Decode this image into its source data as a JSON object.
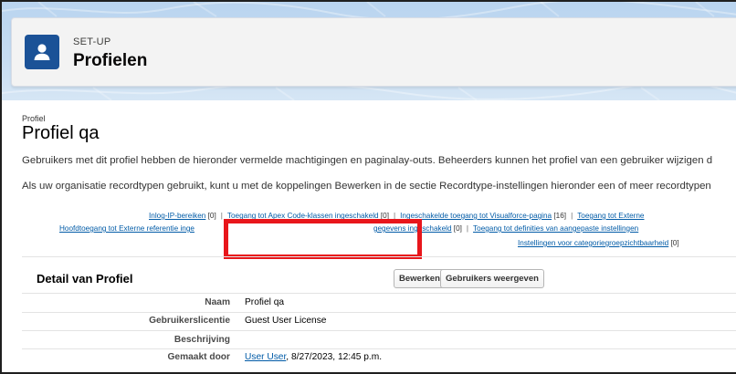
{
  "header": {
    "eyebrow": "SET-UP",
    "title": "Profielen"
  },
  "page": {
    "type_label": "Profiel",
    "title": "Profiel qa",
    "paragraph1": "Gebruikers met dit profiel hebben de hieronder vermelde machtigingen en paginalay-outs. Beheerders kunnen het profiel van een gebruiker wijzigen d",
    "paragraph2": "Als uw organisatie recordtypen gebruikt, kunt u met de koppelingen Bewerken in de sectie Recordtype-instellingen hieronder een of meer recordtypen"
  },
  "links": {
    "login_ip": "Inlog-IP-bereiken",
    "login_ip_count": "[0]",
    "apex_classes": "Toegang tot Apex Code-klassen ingeschakeld",
    "apex_classes_count": "[0]",
    "visualforce": "Ingeschakelde toegang tot Visualforce-pagina",
    "visualforce_count": "[16]",
    "external": "Toegang tot Externe",
    "main_external_prefix": "Hoofdtoegang tot Externe referentie inge",
    "main_external_suffix": "gegevens ingeschakeld",
    "main_external_count": "[0]",
    "custom_settings": "Toegang tot definities van aangepaste instellingen",
    "category_groups": "Instellingen voor categoriegroepzichtbaarheid",
    "category_groups_count": "[0]"
  },
  "detail": {
    "heading": "Detail van Profiel",
    "edit_button": "Bewerken",
    "view_users_button": "Gebruikers weergeven",
    "rows": [
      {
        "label": "Naam",
        "value": "Profiel qa"
      },
      {
        "label": "Gebruikerslicentie",
        "value": "Guest User License"
      },
      {
        "label": "Beschrijving",
        "value": ""
      },
      {
        "label": "Gemaakt door",
        "value": "User User",
        "date": ", 8/27/2023, 12:45 p.m."
      }
    ]
  },
  "colors": {
    "brand_blue": "#1b5297",
    "link": "#015ba7",
    "highlight": "#e8161b"
  }
}
